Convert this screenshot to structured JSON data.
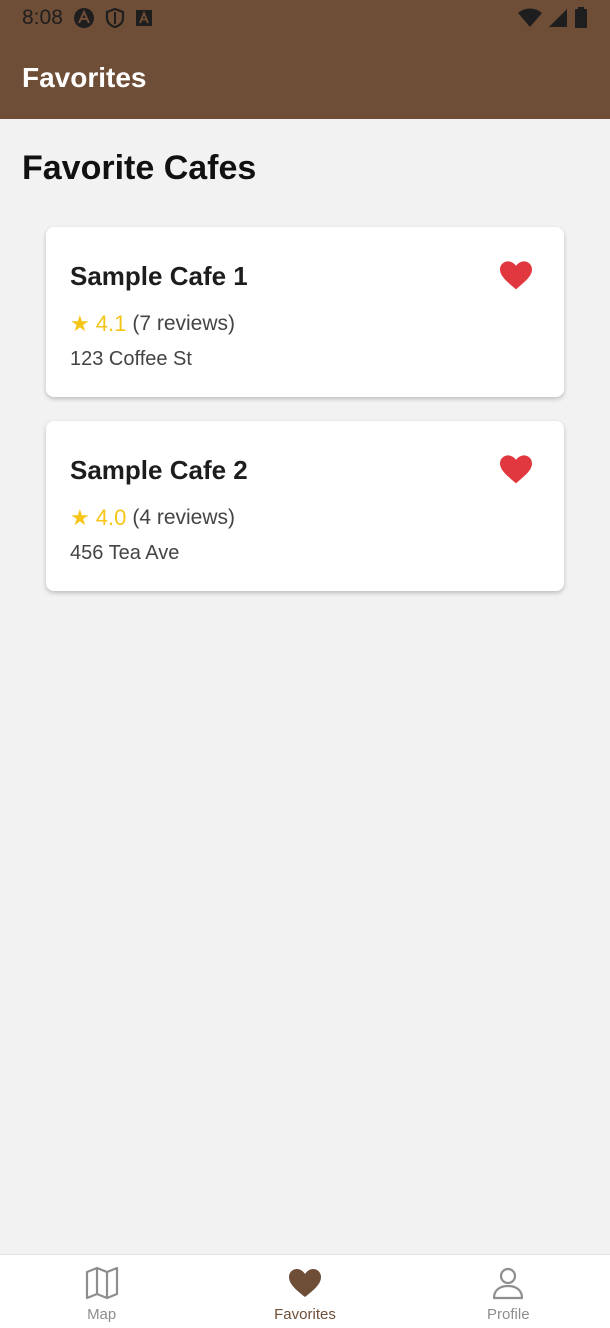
{
  "status_bar": {
    "time": "8:08",
    "icons": [
      "app-a-icon",
      "shield-icon",
      "font-a-icon",
      "wifi-icon",
      "signal-icon",
      "battery-icon"
    ]
  },
  "app_bar": {
    "title": "Favorites"
  },
  "main": {
    "heading": "Favorite Cafes",
    "cafes": [
      {
        "name": "Sample Cafe 1",
        "rating": "4.1",
        "reviews": "(7 reviews)",
        "address": "123 Coffee St",
        "icon": "heart-icon"
      },
      {
        "name": "Sample Cafe 2",
        "rating": "4.0",
        "reviews": "(4 reviews)",
        "address": "456 Tea Ave",
        "icon": "heart-icon"
      }
    ]
  },
  "bottom_nav": {
    "items": [
      {
        "label": "Map",
        "icon": "map-icon",
        "active": false
      },
      {
        "label": "Favorites",
        "icon": "heart-icon",
        "active": true
      },
      {
        "label": "Profile",
        "icon": "person-icon",
        "active": false
      }
    ]
  },
  "colors": {
    "primary": "#6f4e37",
    "heart": "#e0383e",
    "star": "#f5c518",
    "background": "#f2f2f2"
  }
}
